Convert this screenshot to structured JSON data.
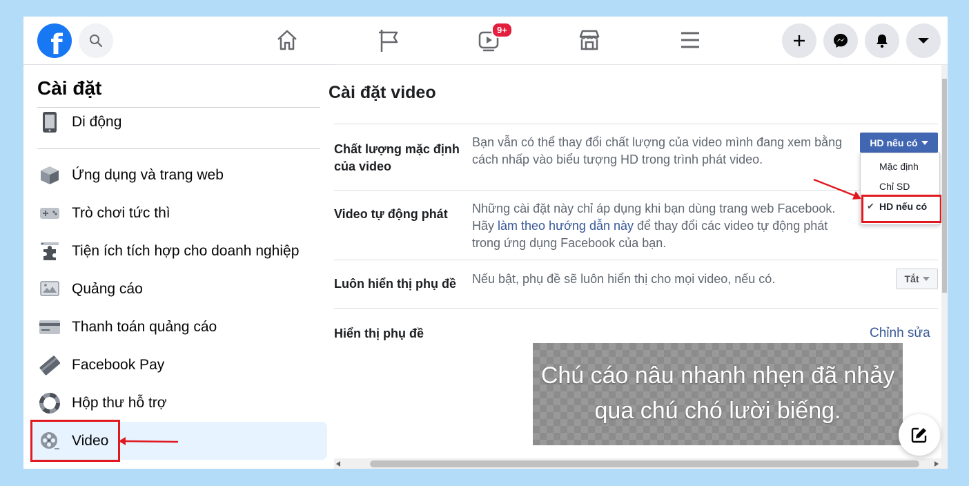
{
  "topbar": {
    "logo_letter": "f",
    "watch_badge": "9+",
    "icons": [
      "home-icon",
      "pages-flag-icon",
      "watch-icon",
      "marketplace-icon",
      "menu-icon",
      "plus-icon",
      "messenger-icon",
      "notifications-icon",
      "account-caret-icon"
    ]
  },
  "sidebar": {
    "title": "Cài đặt",
    "items": [
      {
        "label": "Di động",
        "icon": "mobile-icon"
      },
      {
        "label": "Ứng dụng và trang web",
        "icon": "apps-cube-icon"
      },
      {
        "label": "Trò chơi tức thì",
        "icon": "gamepad-icon"
      },
      {
        "label": "Tiện ích tích hợp cho doanh nghiệp",
        "icon": "business-integrations-icon"
      },
      {
        "label": "Quảng cáo",
        "icon": "ads-icon"
      },
      {
        "label": "Thanh toán quảng cáo",
        "icon": "credit-card-icon"
      },
      {
        "label": "Facebook Pay",
        "icon": "facebook-pay-icon"
      },
      {
        "label": "Hộp thư hỗ trợ",
        "icon": "lifebuoy-icon"
      },
      {
        "label": "Video",
        "icon": "film-reel-icon"
      }
    ]
  },
  "main": {
    "title": "Cài đặt video",
    "rows": [
      {
        "label": "Chất lượng mặc định của video",
        "desc": "Bạn vẫn có thể thay đổi chất lượng của video mình đang xem bằng cách nhấp vào biểu tượng HD trong trình phát video."
      },
      {
        "label": "Video tự động phát",
        "desc_pre": "Những cài đặt này chỉ áp dụng khi bạn dùng trang web Facebook. Hãy ",
        "desc_link": "làm theo hướng dẫn này",
        "desc_post": " để thay đổi các video tự động phát trong ứng dụng Facebook của bạn."
      },
      {
        "label": "Luôn hiển thị phụ đề",
        "desc": "Nếu bật, phụ đề sẽ luôn hiển thị cho mọi video, nếu có."
      },
      {
        "label": "Hiển thị phụ đề",
        "action": "Chỉnh sửa"
      }
    ],
    "quality_select": {
      "value": "HD nếu có",
      "options": [
        "Mặc định",
        "Chỉ SD",
        "HD nếu có"
      ]
    },
    "captions_select": {
      "value": "Tắt"
    },
    "caption_preview": "Chú cáo nâu nhanh nhẹn đã nhảy qua chú chó lười biếng."
  },
  "colors": {
    "accent": "#4267b2",
    "link": "#385898",
    "highlight_red": "#e0191f",
    "background": "#b3dcf9"
  }
}
